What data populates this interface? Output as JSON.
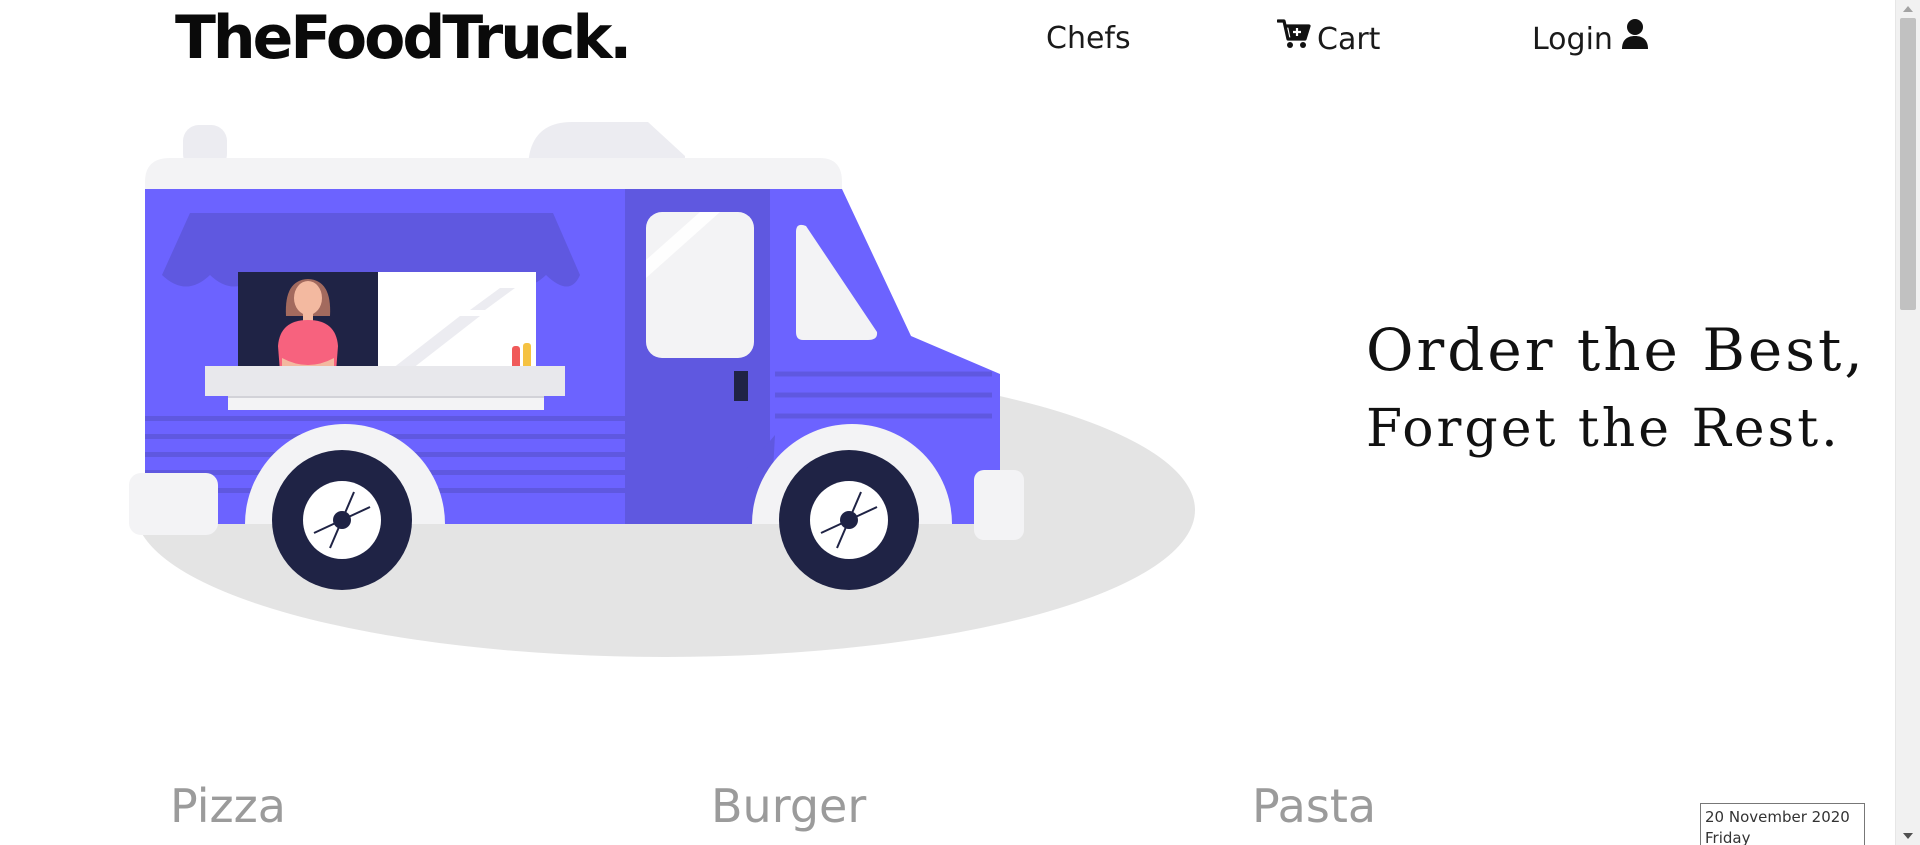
{
  "header": {
    "brand": "TheFoodTruck.",
    "nav": {
      "chefs": "Chefs",
      "cart": "Cart",
      "login": "Login"
    }
  },
  "hero": {
    "tagline_line1": "Order the Best,",
    "tagline_line2": "Forget the Rest.",
    "illustration_icon": "food-truck-illustration"
  },
  "categories": [
    "Pizza",
    "Burger",
    "Pasta"
  ],
  "date_widget": {
    "date": "20 November 2020",
    "day": "Friday"
  },
  "icons": {
    "cart": "cart-icon",
    "login": "user-icon"
  },
  "colors": {
    "truck_body": "#6c63ff",
    "truck_dark_panel": "#5f58e0",
    "wheel": "#1f2345",
    "shadow": "#e4e4e4",
    "category_text": "#9b9b9b"
  }
}
